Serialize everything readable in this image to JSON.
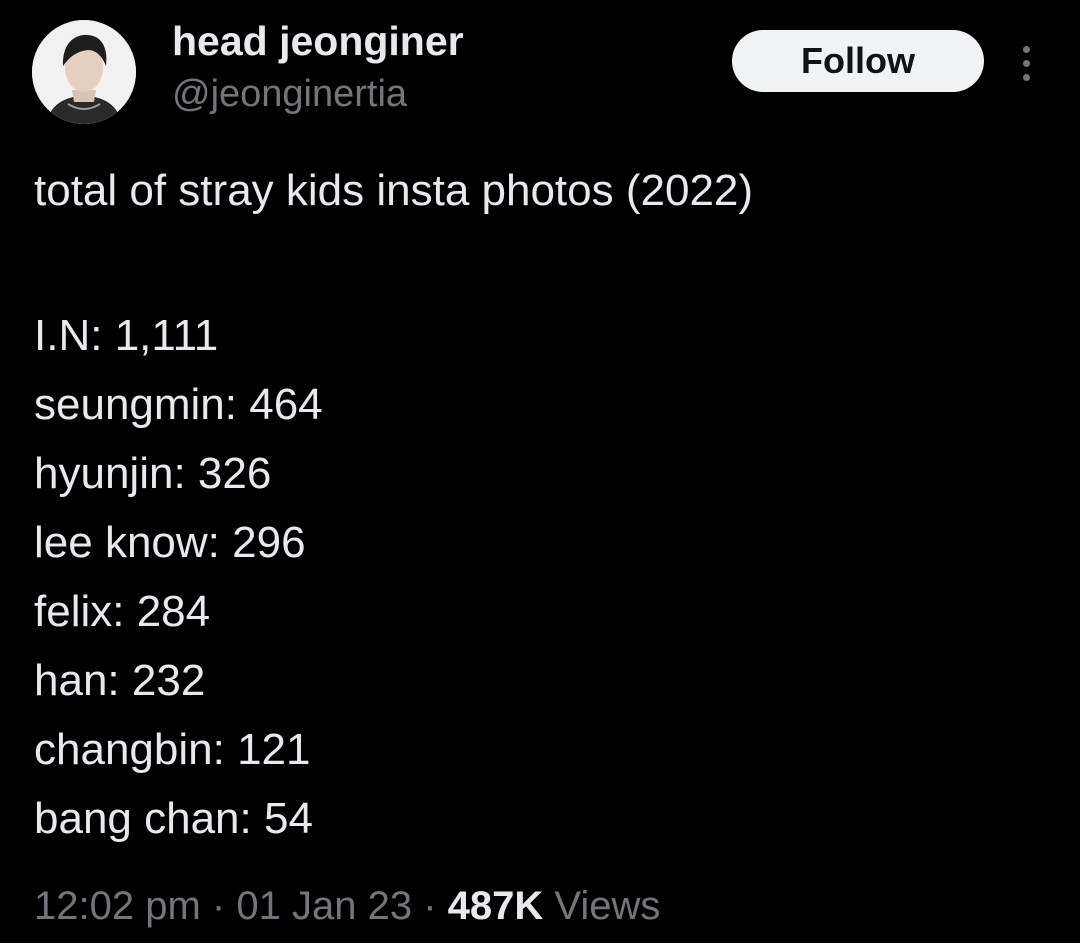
{
  "author": {
    "display_name": "head jeonginer",
    "handle": "@jeonginertia"
  },
  "actions": {
    "follow_label": "Follow"
  },
  "tweet": {
    "title": "total of stray kids insta photos (2022)",
    "entries": [
      {
        "name": "I.N",
        "count": "1,111"
      },
      {
        "name": "seungmin",
        "count": "464"
      },
      {
        "name": "hyunjin",
        "count": "326"
      },
      {
        "name": "lee know",
        "count": "296"
      },
      {
        "name": "felix",
        "count": "284"
      },
      {
        "name": "han",
        "count": "232"
      },
      {
        "name": "changbin",
        "count": "121"
      },
      {
        "name": "bang chan",
        "count": "54"
      }
    ]
  },
  "meta": {
    "time": "12:02 pm",
    "date": "01 Jan 23",
    "views_count": "487K",
    "views_label": "Views",
    "separator": "·"
  },
  "icons": {
    "more": "more-vertical-icon"
  },
  "colors": {
    "background": "#000000",
    "text": "#e7e9ea",
    "secondary": "#71767b",
    "follow_bg": "#eff3f4",
    "follow_text": "#0f1419"
  }
}
